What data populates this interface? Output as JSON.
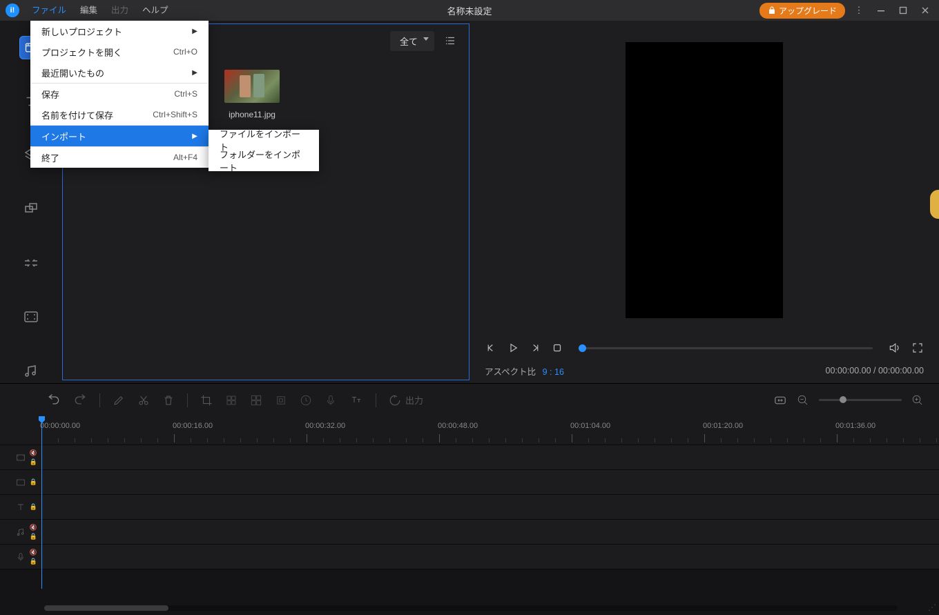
{
  "titlebar": {
    "menu_file": "ファイル",
    "menu_edit": "編集",
    "menu_output": "出力",
    "menu_help": "ヘルプ",
    "title": "名称未設定",
    "upgrade": "アップグレード"
  },
  "file_menu": {
    "new_project": "新しいプロジェクト",
    "open_project": "プロジェクトを開く",
    "open_project_sc": "Ctrl+O",
    "recent": "最近開いたもの",
    "save": "保存",
    "save_sc": "Ctrl+S",
    "save_as": "名前を付けて保存",
    "save_as_sc": "Ctrl+Shift+S",
    "import": "インポート",
    "exit": "終了",
    "exit_sc": "Alt+F4"
  },
  "import_submenu": {
    "import_file": "ファイルをインポート",
    "import_folder": "フォルダーをインポート"
  },
  "media_panel": {
    "filter_all": "全て",
    "items": [
      {
        "name": "iphone11.jpg"
      }
    ]
  },
  "preview": {
    "aspect_label": "アスペクト比",
    "aspect_value": "9 : 16",
    "timecode": "00:00:00.00 / 00:00:00.00"
  },
  "toolbar": {
    "export_label": "出力"
  },
  "timeline": {
    "ticks": [
      "00:00:00.00",
      "00:00:16.00",
      "00:00:32.00",
      "00:00:48.00",
      "00:01:04.00",
      "00:01:20.00",
      "00:01:36.00"
    ]
  }
}
